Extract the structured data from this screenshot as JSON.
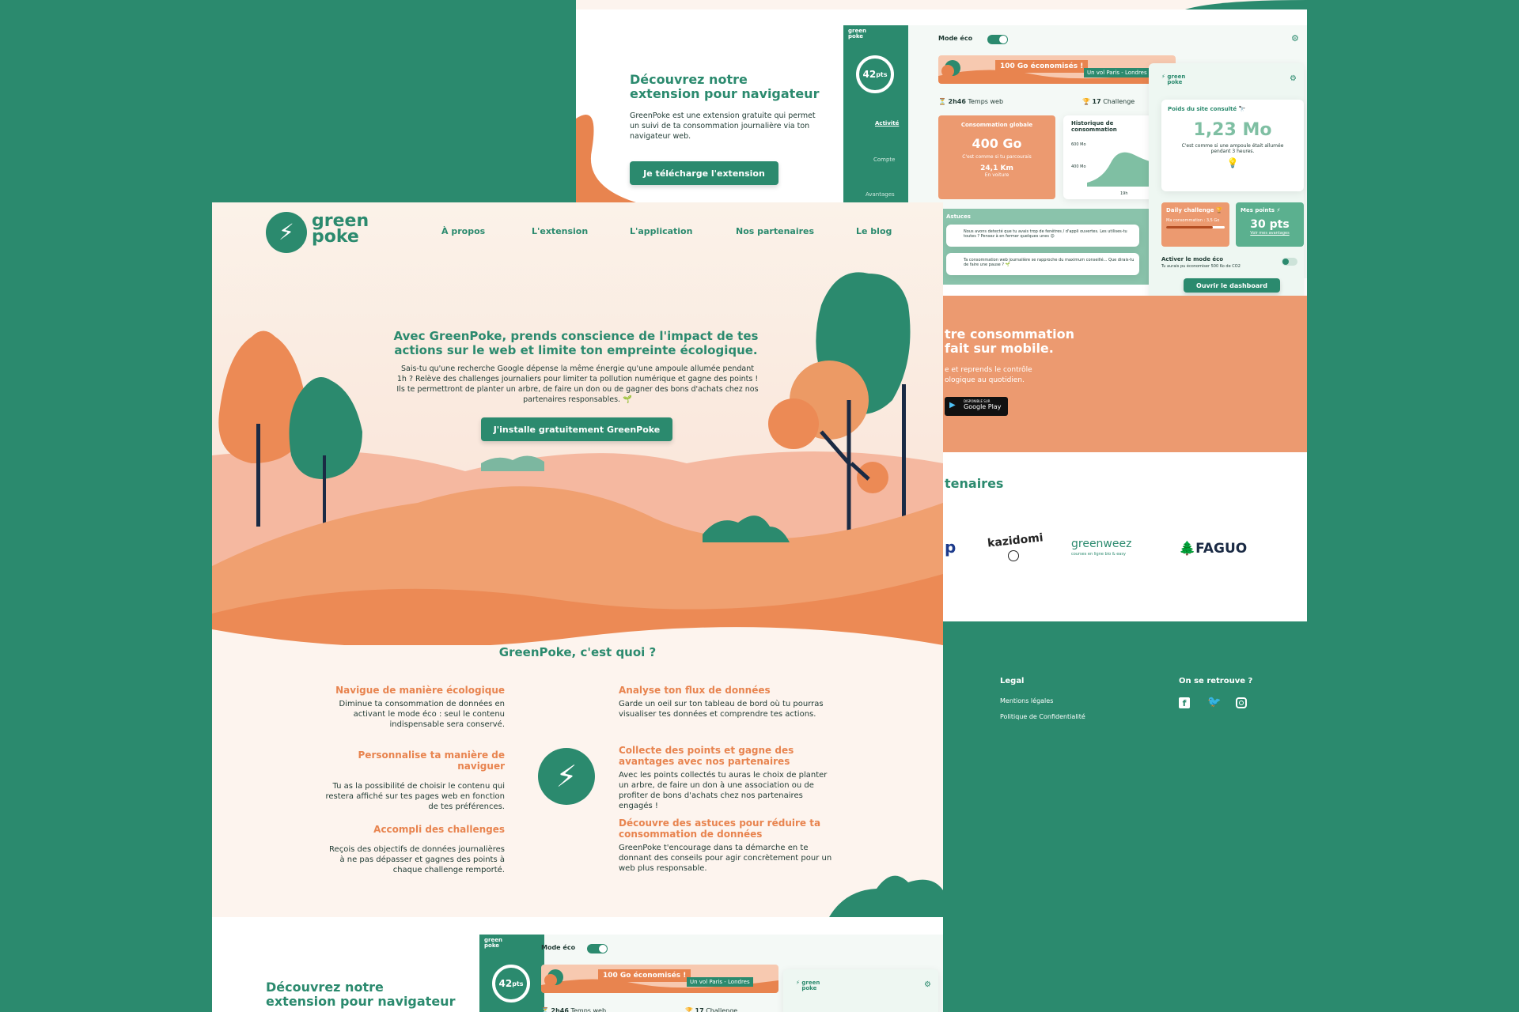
{
  "brand": {
    "line1": "green",
    "line2": "poke",
    "mini1": "green",
    "mini2": "poke"
  },
  "nav": [
    "À propos",
    "L'extension",
    "L'application",
    "Nos partenaires",
    "Le blog"
  ],
  "hero": {
    "title": "Avec GreenPoke, prends conscience de l'impact de tes actions sur le web et limite ton empreinte écologique.",
    "text": "Sais-tu qu'une recherche Google dépense la même énergie qu'une ampoule allumée pendant 1h ? Relève des challenges journaliers pour limiter ta pollution numérique et gagne des points ! Ils te permettront de planter un arbre, de faire un don ou de gagner des bons d'achats chez nos partenaires responsables. 🌱",
    "cta": "J'installe gratuitement GreenPoke"
  },
  "what": {
    "title": "GreenPoke, c'est quoi ?",
    "left": [
      {
        "t": "Navigue de manière écologique",
        "d": "Diminue ta consommation de données en activant le mode éco : seul le contenu indispensable sera conservé."
      },
      {
        "t": "Personnalise ta manière de naviguer",
        "d": "Tu as la possibilité de choisir le contenu qui restera affiché sur tes pages web en fonction de tes préférences."
      },
      {
        "t": "Accompli des challenges",
        "d": "Reçois des objectifs de données journalières à ne pas dépasser et gagnes des points à chaque challenge remporté."
      }
    ],
    "right": [
      {
        "t": "Analyse ton flux de données",
        "d": "Garde un oeil sur ton tableau de bord où tu pourras visualiser tes données et comprendre tes actions."
      },
      {
        "t": "Collecte des points et gagne des avantages avec nos partenaires",
        "d": "Avec les points collectés tu auras le choix de planter un arbre, de faire un don à une association ou de profiter de bons d'achats chez nos partenaires engagés !"
      },
      {
        "t": "Découvre des astuces pour réduire ta consommation de données",
        "d": "GreenPoke t'encourage dans ta démarche en te donnant des conseils pour agir concrètement pour un web plus responsable."
      }
    ]
  },
  "extension": {
    "title": "Découvrez notre extension pour navigateur",
    "text": "GreenPoke est une extension gratuite qui permet un suivi de ta consommation journalière via ton navigateur web.",
    "cta": "Je télécharge l'extension"
  },
  "dashboard": {
    "points": "42",
    "points_unit": "pts",
    "side": [
      "Activité",
      "Compte",
      "Avantages"
    ],
    "mode_eco": "Mode éco",
    "banner": "100 Go économisés !",
    "banner_sub": "Un vol Paris - Londres",
    "time": "2h46",
    "time_label": "Temps web",
    "challenge_n": "17",
    "challenge_label": "Challenge",
    "conso_title": "Consommation globale",
    "conso_value": "400 Go",
    "conso_sub": "C'est comme si tu parcourais",
    "conso_km": "24,1 Km",
    "conso_car": "En voiture",
    "histo_title": "Historique de consommation",
    "histo_y1": "600 Mo",
    "histo_y2": "400 Mo",
    "histo_x": "19h",
    "tips_title": "Astuces",
    "tip1": "Nous avons detecté que tu avais trop de fenêtres / d'appli ouvertes. Les utilises-tu toutes ? Pensez à en fermer quelques unes 😉",
    "tip2": "Ta consommation web journalière se rapproche du maximum conseillé... Que dirais-tu de faire une pause ? 🌱"
  },
  "popup": {
    "weight_title": "Poids du site consulté 🔭",
    "weight_value": "1,23 Mo",
    "weight_text": "C'est comme si une ampoule était allumée pendant 3 heures.",
    "daily_title": "Daily challenge 🏆",
    "daily_text": "Ma consommation : 3,5 Go",
    "pts_title": "Mes points ⚡",
    "pts_value": "30 pts",
    "pts_link": "Voir mes avantages",
    "eco_title": "Activer le mode éco",
    "eco_text": "Tu aurais pu économiser 500 Ko de CO2",
    "cta": "Ouvrir le dashboard"
  },
  "mobile": {
    "title_l1": "tre consommation",
    "title_l2": "fait sur mobile.",
    "text_l1": "e et reprends le contrôle",
    "text_l2": "ologique au quotidien.",
    "store_top": "DISPONIBLE SUR",
    "store": "Google Play"
  },
  "partners": {
    "title": "tenaires",
    "p_cut": "p",
    "kazidomi": "kazidomi",
    "greenweez": "greenweez",
    "greenweez_sub": "courses en ligne bio & easy",
    "faguo": "FAGUO"
  },
  "footer": {
    "legal": "Legal",
    "links": [
      "Mentions légales",
      "Politique de Confidentialité"
    ],
    "social": "On se retrouve ?"
  },
  "colors": {
    "green": "#2b8a6e",
    "orange": "#e8844f",
    "bg": "#2b8a6e",
    "cream": "#fdf4ee"
  }
}
